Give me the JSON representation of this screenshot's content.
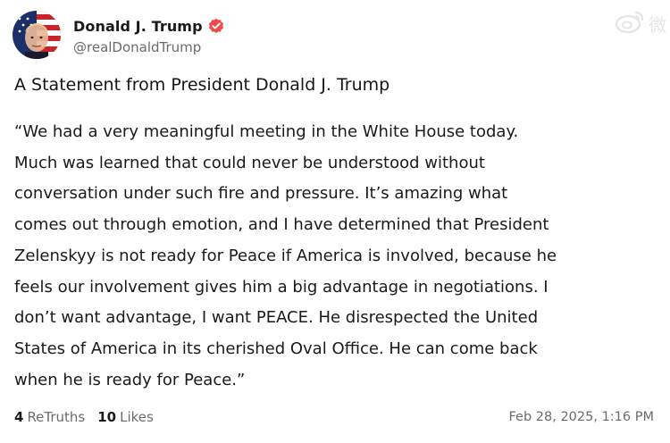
{
  "post": {
    "author": {
      "display_name": "Donald J. Trump",
      "handle": "@realDonaldTrump",
      "verified": true,
      "verified_badge_color": "#ef4a4a",
      "avatar_icon": "flag-portrait-avatar"
    },
    "headline": "A Statement from President Donald J. Trump",
    "body_lines": [
      "“We had a very meaningful meeting in the White House today.",
      "Much was learned that could never be understood without",
      "conversation under such fire and pressure. It’s amazing what",
      "comes out through emotion, and I have determined that President",
      "Zelenskyy is not ready for Peace if America is involved, because he",
      "feels our involvement gives him a big advantage in negotiations. I",
      "don’t want advantage, I want PEACE. He disrespected the United",
      "States of America in its cherished Oval Office. He can come back",
      "when he is ready for Peace.”"
    ],
    "stats": {
      "retruths_count": "4",
      "retruths_label": "ReTruths",
      "likes_count": "10",
      "likes_label": "Likes"
    },
    "timestamp": "Feb 28, 2025, 1:16 PM"
  },
  "watermark": {
    "icon": "weibo-logo-icon",
    "text": "微"
  }
}
